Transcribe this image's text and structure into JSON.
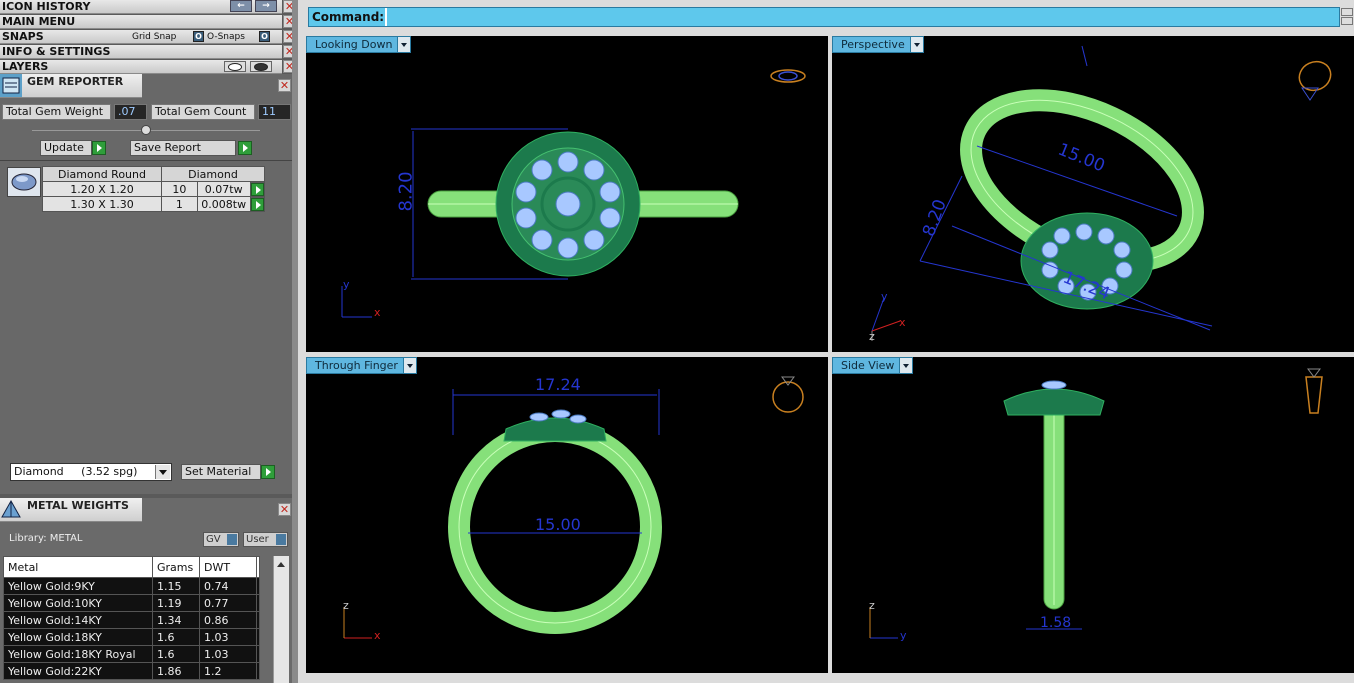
{
  "panels": {
    "icon_history": "ICON HISTORY",
    "main_menu": "MAIN MENU",
    "snaps": "SNAPS",
    "grid_snap": "Grid Snap",
    "o_snaps": "O-Snaps",
    "info_settings": "INFO & SETTINGS",
    "layers": "LAYERS"
  },
  "gem_reporter": {
    "title": "GEM REPORTER",
    "total_weight_label": "Total Gem Weight",
    "total_weight_value": ".07",
    "total_count_label": "Total Gem Count",
    "total_count_value": "11",
    "update_label": "Update",
    "save_report_label": "Save Report",
    "col_shape": "Diamond Round",
    "col_material": "Diamond",
    "rows": [
      {
        "size": "1.20 X 1.20",
        "qty": "10",
        "tw": "0.07tw"
      },
      {
        "size": "1.30 X 1.30",
        "qty": "1",
        "tw": "0.008tw"
      }
    ],
    "material_select": "Diamond     (3.52 spg)",
    "set_material_label": "Set Material"
  },
  "metal_weights": {
    "title": "METAL WEIGHTS",
    "library_label": "Library: METAL",
    "gv_label": "GV",
    "user_label": "User",
    "headers": [
      "Metal",
      "Grams",
      "DWT"
    ],
    "rows": [
      [
        "Yellow Gold:9KY",
        "1.15",
        "0.74"
      ],
      [
        "Yellow Gold:10KY",
        "1.19",
        "0.77"
      ],
      [
        "Yellow Gold:14KY",
        "1.34",
        "0.86"
      ],
      [
        "Yellow Gold:18KY",
        "1.6",
        "1.03"
      ],
      [
        "Yellow Gold:18KY Royal",
        "1.6",
        "1.03"
      ],
      [
        "Yellow Gold:22KY",
        "1.86",
        "1.2"
      ]
    ]
  },
  "command": {
    "label": "Command:",
    "value": ""
  },
  "viewports": {
    "top_left": {
      "label": "Looking Down",
      "dim": "8.20",
      "axis_y": "y",
      "axis_x": "x"
    },
    "top_right": {
      "label": "Perspective",
      "dim_a": "15.00",
      "dim_b": "8.20",
      "dim_c": "17.24",
      "axis_y": "y",
      "axis_x": "x",
      "axis_z": "z"
    },
    "bottom_left": {
      "label": "Through Finger",
      "dim_outer": "17.24",
      "dim_inner": "15.00",
      "axis_z": "z",
      "axis_x": "x"
    },
    "bottom_right": {
      "label": "Side View",
      "dim": "1.58",
      "axis_z": "z",
      "axis_y": "y"
    }
  }
}
